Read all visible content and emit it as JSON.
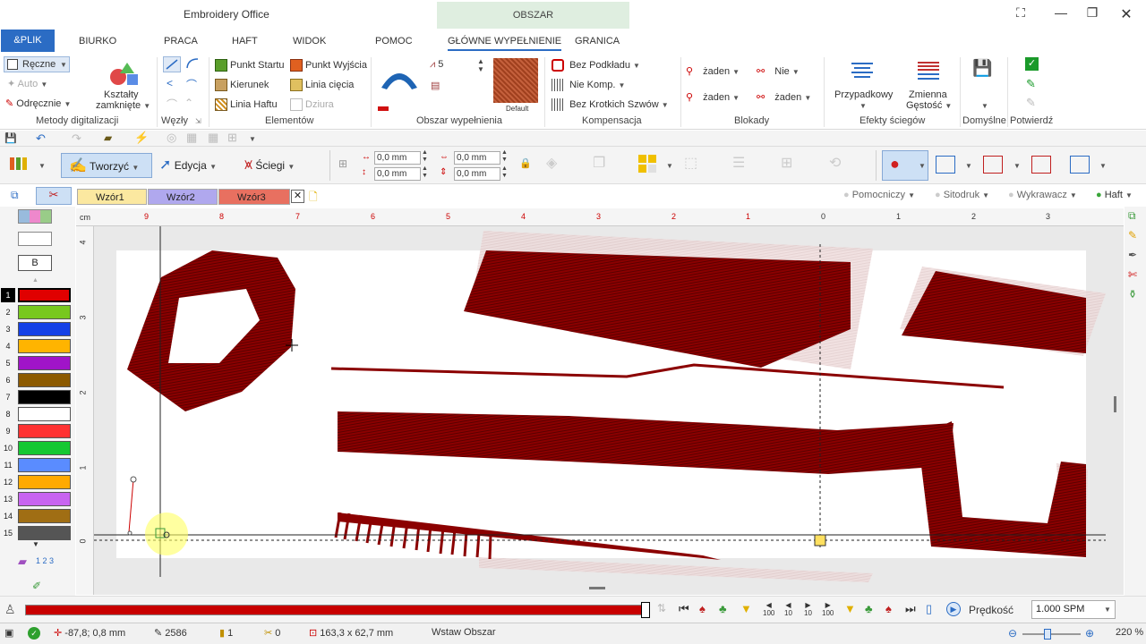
{
  "window": {
    "title": "Embroidery Office",
    "context_tab": "OBSZAR"
  },
  "menu": {
    "file": "&PLIK",
    "items": [
      "BIURKO",
      "PRACA",
      "HAFT",
      "WIDOK",
      "POMOC",
      "GŁÓWNE WYPEŁNIENIE",
      "GRANICA"
    ]
  },
  "ribbon": {
    "digitize": {
      "items": [
        "Ręczne",
        "Auto",
        "Odręcznie"
      ],
      "shapes": "Kształty",
      "shapes2": "zamknięte",
      "group": "Metody digitalizacji"
    },
    "nodes": {
      "group": "Węzły"
    },
    "elements": {
      "items": [
        "Punkt Startu",
        "Punkt Wyjścia",
        "Kierunek",
        "Linia cięcia",
        "Linia Haftu",
        "Dziura"
      ],
      "group": "Elementów"
    },
    "fill": {
      "count": "5",
      "swatch_label": "Default",
      "group": "Obszar wypełnienia"
    },
    "comp": {
      "items": [
        "Bez Podkładu",
        "Nie Komp.",
        "Bez Krotkich Szwów"
      ],
      "group": "Kompensacja"
    },
    "locks": {
      "items": [
        "żaden",
        "Nie",
        "żaden",
        "żaden"
      ],
      "group": "Blokady"
    },
    "effects": {
      "a": "Przypadkowy",
      "b1": "Zmienna",
      "b2": "Gęstość",
      "group": "Efekty ściegów"
    },
    "defaults": {
      "group": "Domyślne"
    },
    "confirm": {
      "group": "Potwierdź"
    }
  },
  "toolbar2": {
    "create": "Tworzyć",
    "edit": "Edycja",
    "stitches": "Ściegi",
    "fields": [
      "0,0 mm",
      "0,0 mm",
      "0,0 mm",
      "0,0 mm"
    ]
  },
  "doc_tabs": [
    "Wzór1",
    "Wzór2",
    "Wzór3"
  ],
  "layers": [
    "Pomocniczy",
    "Sitodruk",
    "Wykrawacz",
    "Haft"
  ],
  "palette": {
    "header": "B",
    "colors": [
      {
        "n": "1",
        "c": "#e00000"
      },
      {
        "n": "2",
        "c": "#78c81e"
      },
      {
        "n": "3",
        "c": "#1440e6"
      },
      {
        "n": "4",
        "c": "#ffb400"
      },
      {
        "n": "5",
        "c": "#a014c8"
      },
      {
        "n": "6",
        "c": "#8c5a00"
      },
      {
        "n": "7",
        "c": "#000000"
      },
      {
        "n": "8",
        "c": "#ffffff"
      },
      {
        "n": "9",
        "c": "#ff3232"
      },
      {
        "n": "10",
        "c": "#14c832"
      },
      {
        "n": "11",
        "c": "#5a8cff"
      },
      {
        "n": "12",
        "c": "#ffaa00"
      },
      {
        "n": "13",
        "c": "#c864f0"
      },
      {
        "n": "14",
        "c": "#a06e14"
      },
      {
        "n": "15",
        "c": "#555555"
      }
    ],
    "seq": "1 2 3"
  },
  "ruler": {
    "unit": "cm",
    "top_labels": [
      "9",
      "8",
      "7",
      "6",
      "5",
      "4",
      "3",
      "2",
      "1",
      "0",
      "1",
      "2",
      "3"
    ],
    "left_labels": [
      "4",
      "3",
      "2",
      "1",
      "0"
    ]
  },
  "playback": {
    "speed_label": "Prędkość",
    "speed_value": "1.000 SPM",
    "steps": [
      "100",
      "10",
      "10",
      "100"
    ],
    "progress": 1.0
  },
  "status": {
    "coords": "-87,8; 0,8 mm",
    "stitches": "2586",
    "colors": "1",
    "trims": "0",
    "size": "163,3 x 62,7 mm",
    "mode": "Wstaw Obszar",
    "zoom": "220 %"
  },
  "colors": {
    "accent": "#2b6cc4",
    "stitch": "#8b0000",
    "progress": "#c80000"
  }
}
